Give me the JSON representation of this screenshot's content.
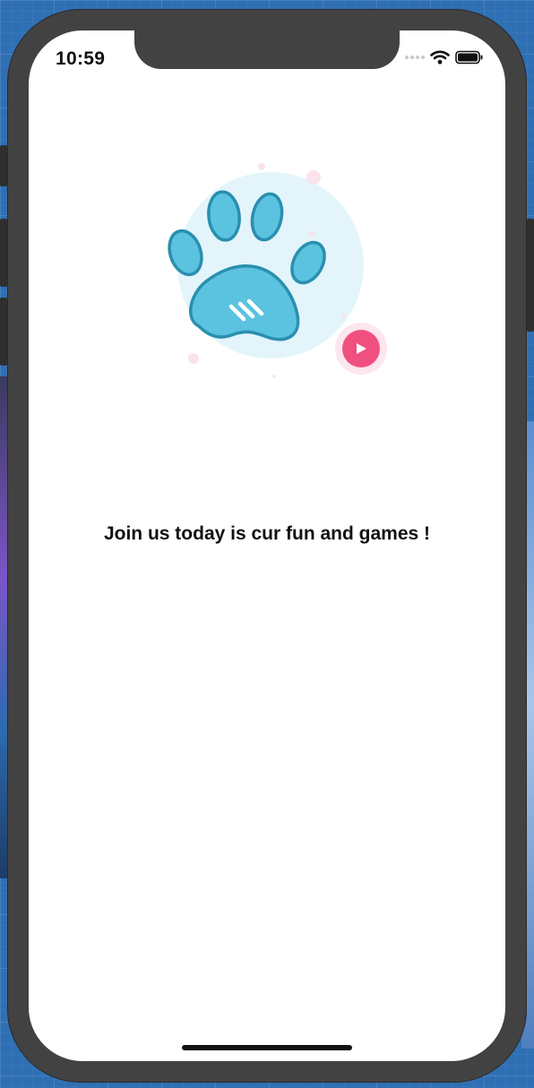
{
  "status_bar": {
    "time": "10:59",
    "icons": [
      "signal-icon",
      "wifi-icon",
      "battery-icon"
    ]
  },
  "illustration": {
    "icons": [
      "paw-icon",
      "play-icon"
    ],
    "colors": {
      "circle": "#e3f5fb",
      "paw_fill": "#5bc3df",
      "paw_stroke": "#2a8fae",
      "play_button": "#f0507f"
    }
  },
  "main": {
    "tagline": "Join us today is cur fun and games !"
  }
}
